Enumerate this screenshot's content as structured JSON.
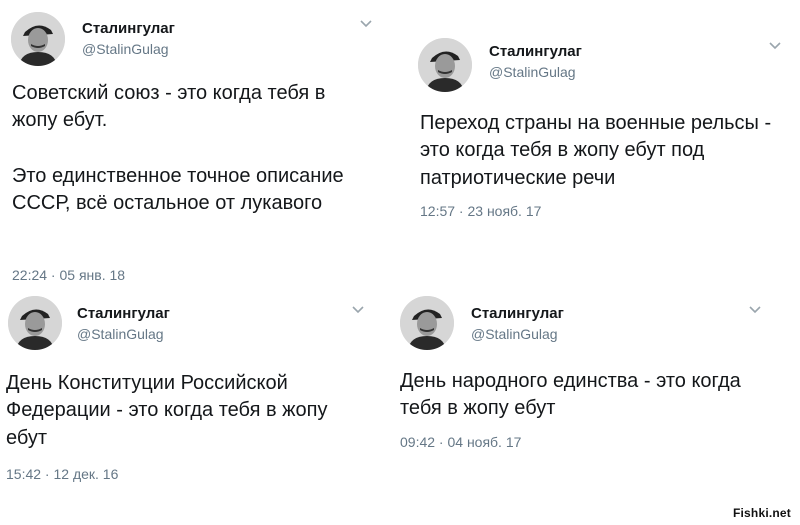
{
  "tweets": [
    {
      "author": "Сталингулаг",
      "handle": "@StalinGulag",
      "text1": "Советский союз - это когда тебя в жопу ебут.",
      "text2": "Это единственное точное описание СССР, всё остальное от лукавого",
      "time": "22:24 · 05 янв. 18"
    },
    {
      "author": "Сталингулаг",
      "handle": "@StalinGulag",
      "text1": "Переход страны на военные рельсы - это когда тебя в жопу ебут под патриотические речи",
      "time": "12:57 · 23 нояб. 17"
    },
    {
      "author": "Сталингулаг",
      "handle": "@StalinGulag",
      "text1": "День Конституции Российской Федерации - это когда тебя в жопу ебут",
      "time": "15:42 · 12 дек. 16"
    },
    {
      "author": "Сталингулаг",
      "handle": "@StalinGulag",
      "text1": "День народного единства - это когда тебя в жопу ебут",
      "time": "09:42 · 04 нояб. 17"
    }
  ],
  "watermark": "Fishki.net",
  "icons": {
    "avatar": "user-avatar-icon",
    "menu": "chevron-down-icon"
  },
  "colors": {
    "secondary_text": "#657786",
    "primary_text": "#14171a"
  }
}
